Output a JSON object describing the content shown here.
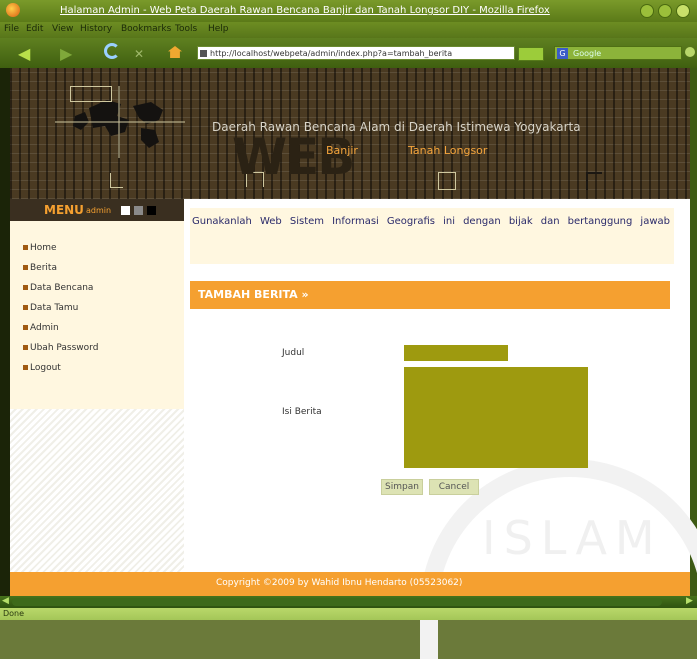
{
  "window": {
    "title": "Halaman Admin - Web Peta Daerah Rawan Bencana Banjir dan Tanah Longsor DIY - Mozilla Firefox"
  },
  "menubar": {
    "items": [
      "File",
      "Edit",
      "View",
      "History",
      "Bookmarks",
      "Tools",
      "Help"
    ]
  },
  "navbar": {
    "url": "http://localhost/webpeta/admin/index.php?a=tambah_berita",
    "search_placeholder": "Google"
  },
  "banner": {
    "logo_text": "WEB",
    "title": "Daerah Rawan Bencana Alam di Daerah Istimewa Yogyakarta",
    "link_banjir": "Banjir",
    "link_tanah": "Tanah Longsor"
  },
  "sidebar": {
    "menu_title": "MENU",
    "menu_sub": "admin",
    "items": [
      {
        "label": "Home"
      },
      {
        "label": "Berita"
      },
      {
        "label": "Data Bencana"
      },
      {
        "label": "Data Tamu"
      },
      {
        "label": "Admin"
      },
      {
        "label": "Ubah Password"
      },
      {
        "label": "Logout"
      }
    ]
  },
  "content": {
    "intro": "Gunakanlah Web Sistem Informasi Geografis ini dengan bijak dan bertanggung jawab",
    "section_title": "TAMBAH BERITA »",
    "form": {
      "judul_label": "Judul",
      "isi_label": "Isi Berita",
      "judul_value": "",
      "isi_value": "",
      "simpan_label": "Simpan",
      "cancel_label": "Cancel"
    },
    "watermark": "ISLAM"
  },
  "footer": {
    "text": "Copyright ©2009 by Wahid Ibnu Hendarto (05523062)"
  },
  "statusbar": {
    "text": "Done"
  },
  "colors": {
    "accent_orange": "#f5a030",
    "form_field": "#9e9a0f",
    "menu_head": "#3a2f20"
  }
}
